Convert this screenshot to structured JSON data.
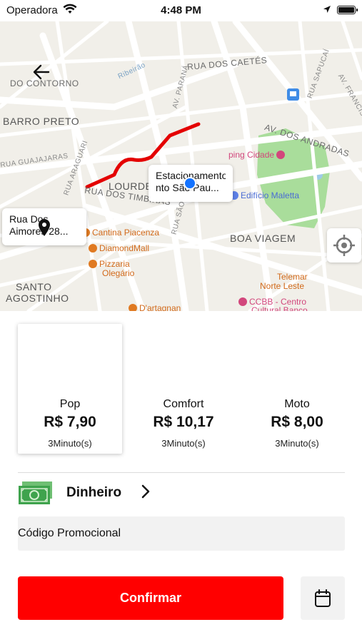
{
  "status_bar": {
    "carrier": "Operadora",
    "time": "4:48 PM",
    "icons": [
      "wifi-icon",
      "location-arrow-icon",
      "battery-icon"
    ]
  },
  "map": {
    "neighborhoods": [
      "BARRO PRETO",
      "LOURDES",
      "BOA VIAGEM",
      "SANTO",
      "AGOSTINHO"
    ],
    "streets": [
      "RUA DOS CAETÉS",
      "RUA DOS TIMBIRAS",
      "AV. DOS ANDRADAS",
      "AV. FRANCISCO",
      "RUA GUAJAJARAS",
      "RUA ARAGUARI",
      "AV. PARANÁ",
      "RUA SÃO",
      "RUA SAPUCAÍ",
      "DO CONTORNO",
      "Ribeirão"
    ],
    "pois": [
      {
        "label": "Cantina Piacenza",
        "color": "#e07a22"
      },
      {
        "label": "DiamondMall",
        "color": "#e07a22"
      },
      {
        "label": "Pizzaria",
        "color": "#e07a22"
      },
      {
        "label": "Olegário",
        "color": "#e07a22"
      },
      {
        "label": "D'artagnan",
        "color": "#e07a22"
      },
      {
        "label": "Edifício Maletta",
        "color": "#5c7fe6"
      },
      {
        "label": "Telemar",
        "color": "#d26a1b"
      },
      {
        "label": "Norte Leste",
        "color": "#d26a1b"
      },
      {
        "label": "CCBB - Centro",
        "color": "#d2477c"
      },
      {
        "label": "Cultural Banco",
        "color": "#d2477c"
      },
      {
        "label": "ping Cidade",
        "color": "#d2477c"
      }
    ],
    "origin_callout": {
      "line1": "Rua Dos",
      "line2": "Aimores 28..."
    },
    "dest_callout": {
      "line1": "Estacionamento",
      "line2": "nto São Pau..."
    },
    "route_color": "#e40000",
    "park_color": "#a9dd9b"
  },
  "vehicles": [
    {
      "name": "Pop",
      "price": "R$ 7,90",
      "eta": "3Minuto(s)",
      "selected": true
    },
    {
      "name": "Comfort",
      "price": "R$ 10,17",
      "eta": "3Minuto(s)",
      "selected": false
    },
    {
      "name": "Moto",
      "price": "R$ 8,00",
      "eta": "3Minuto(s)",
      "selected": false
    }
  ],
  "payment": {
    "label": "Dinheiro",
    "icon": "cash-icon"
  },
  "promo": {
    "label": "Código Promocional"
  },
  "confirm": {
    "label": "Confirmar",
    "color": "#ff0000"
  },
  "schedule": {
    "icon": "calendar-icon"
  }
}
